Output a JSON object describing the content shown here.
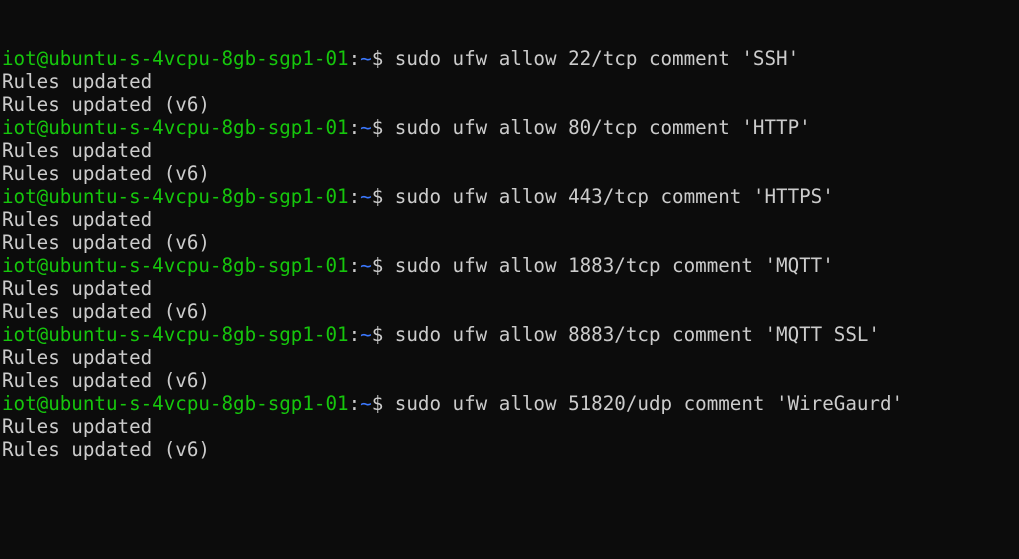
{
  "terminal": {
    "colors": {
      "background": "#0c0c0c",
      "text": "#cccccc",
      "prompt_user": "#16c60c",
      "prompt_path": "#3b78ff"
    },
    "prompt": {
      "user_host": "iot@ubuntu-s-4vcpu-8gb-sgp1-01",
      "separator": ":",
      "path": "~",
      "symbol": "$"
    },
    "entries": [
      {
        "command": " sudo ufw allow 22/tcp comment 'SSH'",
        "output": [
          "Rules updated",
          "Rules updated (v6)"
        ]
      },
      {
        "command": " sudo ufw allow 80/tcp comment 'HTTP'",
        "output": [
          "Rules updated",
          "Rules updated (v6)"
        ]
      },
      {
        "command": " sudo ufw allow 443/tcp comment 'HTTPS'",
        "output": [
          "Rules updated",
          "Rules updated (v6)"
        ]
      },
      {
        "command": " sudo ufw allow 1883/tcp comment 'MQTT'",
        "output": [
          "Rules updated",
          "Rules updated (v6)"
        ]
      },
      {
        "command": " sudo ufw allow 8883/tcp comment 'MQTT SSL'",
        "output": [
          "Rules updated",
          "Rules updated (v6)"
        ]
      },
      {
        "command": " sudo ufw allow 51820/udp comment 'WireGaurd'",
        "output": [
          "Rules updated",
          "Rules updated (v6)"
        ]
      }
    ]
  }
}
